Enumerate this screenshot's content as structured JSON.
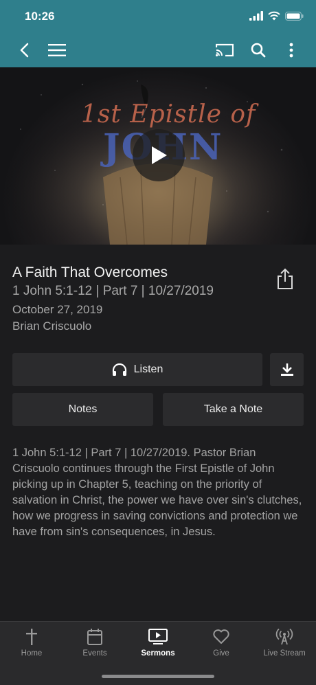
{
  "status_bar": {
    "time": "10:26"
  },
  "hero": {
    "title_line1": "1st Epistle of",
    "title_line2": "JOHN"
  },
  "sermon": {
    "title": "A Faith That Overcomes",
    "subtitle": "1 John 5:1-12 | Part 7 | 10/27/2019",
    "date": "October 27, 2019",
    "speaker": "Brian Criscuolo",
    "description": "1 John 5:1-12 | Part 7 | 10/27/2019. Pastor Brian Criscuolo continues through the First Epistle of John picking up in Chapter 5, teaching on the priority of salvation in Christ, the power we have over sin's clutches, how we progress in saving convictions and protection we have from sin's consequences, in Jesus."
  },
  "actions": {
    "listen": "Listen",
    "notes": "Notes",
    "take_note": "Take a Note"
  },
  "tabs": [
    {
      "label": "Home",
      "icon": "cross-icon"
    },
    {
      "label": "Events",
      "icon": "calendar-icon"
    },
    {
      "label": "Sermons",
      "icon": "video-icon"
    },
    {
      "label": "Give",
      "icon": "heart-icon"
    },
    {
      "label": "Live Stream",
      "icon": "broadcast-icon"
    }
  ],
  "colors": {
    "header": "#2f7f8c",
    "background": "#1c1c1e",
    "button": "#2b2b2d"
  }
}
